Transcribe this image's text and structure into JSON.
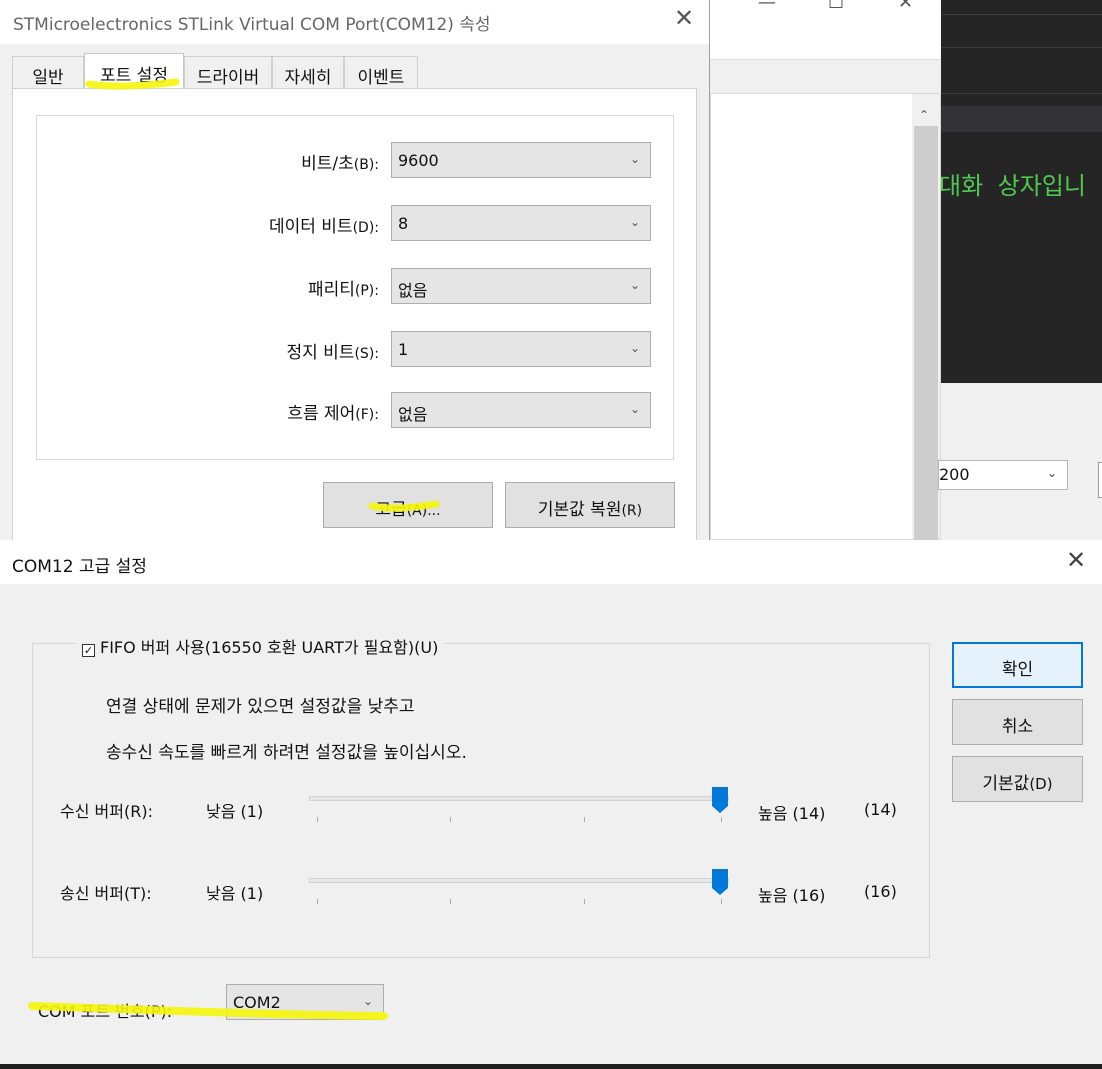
{
  "background_window": {
    "minimize": "—",
    "maximize": "☐",
    "close": "✕",
    "scroll_up": "⌃",
    "terminal_text": "대화 상자입니",
    "select_value": "200",
    "chevron": "⌄"
  },
  "properties_dialog": {
    "title": "STMicroelectronics STLink Virtual COM Port(COM12) 속성",
    "close": "✕",
    "tabs": [
      "일반",
      "포트 설정",
      "드라이버",
      "자세히",
      "이벤트"
    ],
    "active_tab": "포트 설정",
    "rows": [
      {
        "label": "비트/초",
        "accel": "(B):",
        "value": "9600"
      },
      {
        "label": "데이터 비트",
        "accel": "(D):",
        "value": "8"
      },
      {
        "label": "패리티",
        "accel": "(P):",
        "value": "없음"
      },
      {
        "label": "정지 비트",
        "accel": "(S):",
        "value": "1"
      },
      {
        "label": "흐름 제어",
        "accel": "(F):",
        "value": "없음"
      }
    ],
    "chevron": "⌄",
    "advanced_button": {
      "label": "고급",
      "accel": "(A)..."
    },
    "restore_button": {
      "label": "기본값 복원",
      "accel": "(R)"
    }
  },
  "advanced_dialog": {
    "title": "COM12 고급 설정",
    "close": "✕",
    "fifo_checkbox": {
      "label": "FIFO 버퍼 사용(16550 호환 UART가 필요함)(U)",
      "checked": true,
      "mark": "✓"
    },
    "note_line1": "연결 상태에 문제가 있으면 설정값을 낮추고",
    "note_line2": "송수신 속도를 빠르게 하려면 설정값을 높이십시오.",
    "receive_buffer": {
      "label": "수신 버퍼(R):",
      "low": "낮음 (1)",
      "high": "높음 (14)",
      "value_text": "(14)",
      "min": 1,
      "max": 14,
      "value": 14
    },
    "transmit_buffer": {
      "label": "송신 버퍼(T):",
      "low": "낮음 (1)",
      "high": "높음 (16)",
      "value_text": "(16)",
      "min": 1,
      "max": 16,
      "value": 16
    },
    "ok_button": "확인",
    "cancel_button": "취소",
    "defaults_button": {
      "label": "기본값",
      "accel": "(D)"
    },
    "com_port_label": "COM 포트 번호(P):",
    "com_port_value": "COM2",
    "chevron": "⌄"
  },
  "colors": {
    "highlight": "#f5f50a",
    "accent": "#0078d7",
    "terminal_green": "#4ec94e"
  }
}
